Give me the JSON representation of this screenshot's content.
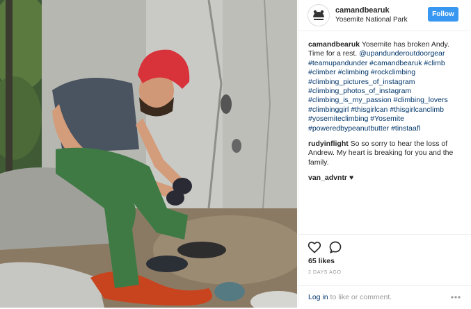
{
  "post": {
    "username": "camandbearuk",
    "location": "Yosemite National Park",
    "follow_label": "Follow",
    "caption": {
      "user": "camandbearuk",
      "text": "Yosemite has broken Andy. Time for a rest.",
      "rest": "@upandunderoutdoorgear #teamupandunder #camandbearuk #climb #climber #climbing #rockclimbing #climbing_pictures_of_instagram #climbing_photos_of_instagram #climbing_is_my_passion #climbing_lovers #climbinggirl #thisgirlcan #thisgirlcanclimb #yosemiteclimbing #Yosemite #poweredbypeanutbutter #tinstaafl"
    },
    "comments": [
      {
        "user": "rudyinflight",
        "text": "So so sorry to hear the loss of Andrew. My heart is breaking for you and the family."
      },
      {
        "user": "van_advntr",
        "text": "♥"
      }
    ],
    "likes": "65 likes",
    "timestamp": "2 DAYS AGO",
    "login_link": "Log in",
    "login_rest": "to like or comment."
  },
  "icons": {
    "like": "heart-icon",
    "comment": "comment-bubble-icon",
    "more": "more-options-icon"
  },
  "colors": {
    "follow_button": "#3897f0",
    "hashtag": "#003569",
    "muted": "#999999"
  }
}
